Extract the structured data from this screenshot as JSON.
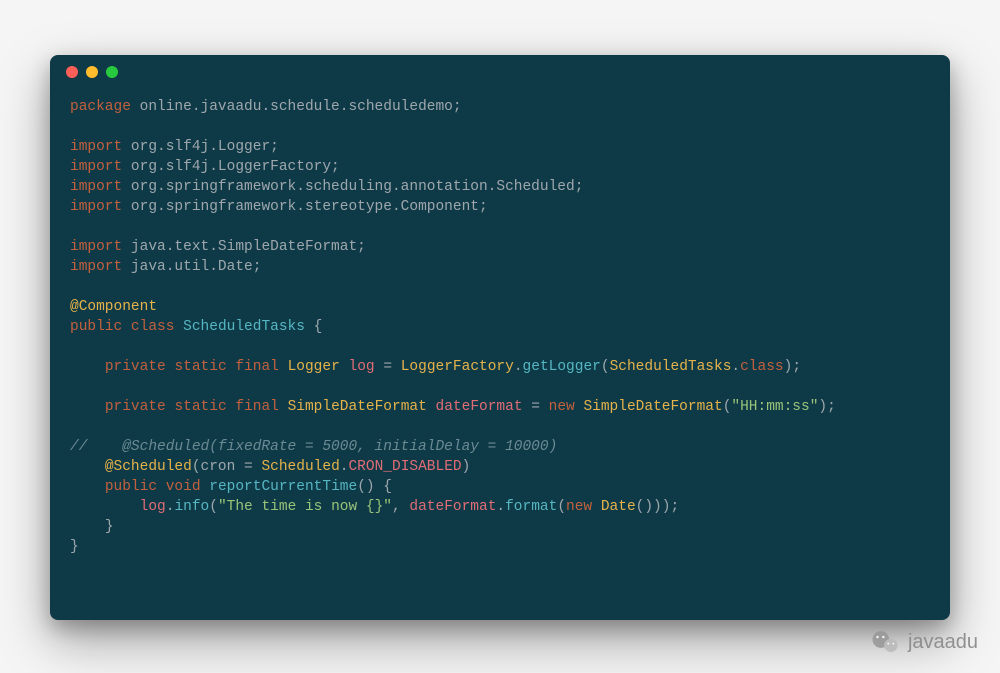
{
  "window": {
    "dots": [
      "red",
      "yellow",
      "green"
    ]
  },
  "code": {
    "line01_kw": "package",
    "line01_pkg": " online.javaadu.schedule.scheduledemo;",
    "line03_kw": "import",
    "line03_pkg": " org.slf4j.Logger;",
    "line04_kw": "import",
    "line04_pkg": " org.slf4j.LoggerFactory;",
    "line05_kw": "import",
    "line05_pkg": " org.springframework.scheduling.annotation.Scheduled;",
    "line06_kw": "import",
    "line06_pkg": " org.springframework.stereotype.Component;",
    "line08_kw": "import",
    "line08_pkg": " java.text.SimpleDateFormat;",
    "line09_kw": "import",
    "line09_pkg": " java.util.Date;",
    "line11_ann": "@Component",
    "line12_kw1": "public",
    "line12_kw2": "class",
    "line12_cls": "ScheduledTasks",
    "line12_brace": "{",
    "line14_kw1": "private",
    "line14_kw2": "static",
    "line14_kw3": "final",
    "line14_type": "Logger",
    "line14_var": "log",
    "line14_eq": "=",
    "line14_factory": "LoggerFactory",
    "line14_method": "getLogger",
    "line14_arg": "ScheduledTasks",
    "line14_class": "class",
    "line16_kw1": "private",
    "line16_kw2": "static",
    "line16_kw3": "final",
    "line16_type": "SimpleDateFormat",
    "line16_var": "dateFormat",
    "line16_eq": "=",
    "line16_new": "new",
    "line16_ctor": "SimpleDateFormat",
    "line16_str": "\"HH:mm:ss\"",
    "line18_cmt": "//    @Scheduled(fixedRate = 5000, initialDelay = 10000)",
    "line19_ann": "@Scheduled",
    "line19_par": "cron",
    "line19_eq": "=",
    "line19_type": "Scheduled",
    "line19_const": "CRON_DISABLED",
    "line20_kw1": "public",
    "line20_kw2": "void",
    "line20_method": "reportCurrentTime",
    "line20_brace": "{",
    "line21_var": "log",
    "line21_method": "info",
    "line21_str": "\"The time is now {}\"",
    "line21_var2": "dateFormat",
    "line21_method2": "format",
    "line21_new": "new",
    "line21_type": "Date",
    "line22_brace": "}",
    "line23_brace": "}"
  },
  "watermark": {
    "text": "javaadu"
  }
}
